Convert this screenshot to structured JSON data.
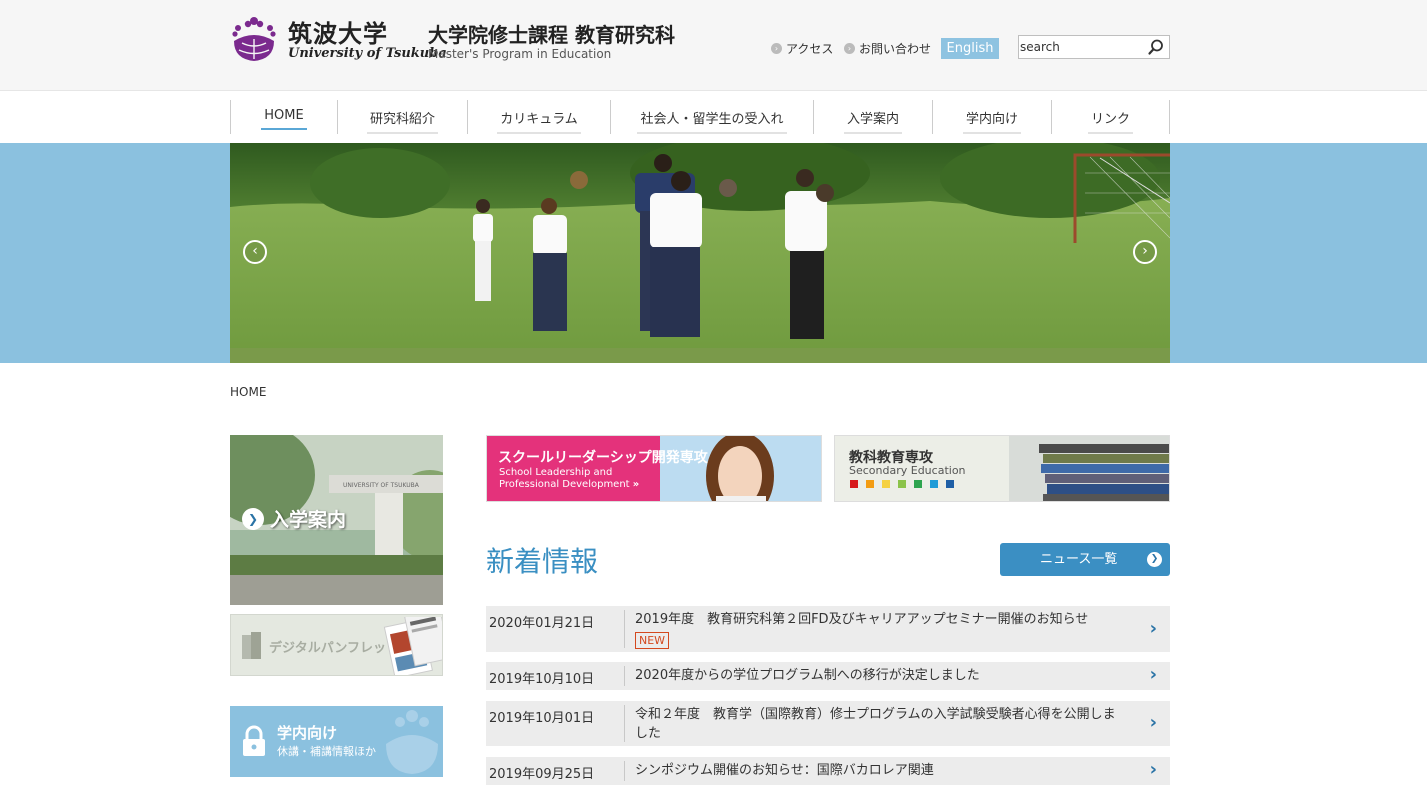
{
  "header": {
    "university_jp": "筑波大学",
    "university_en": "University of Tsukuba",
    "program_jp": "大学院修士課程 教育研究科",
    "program_en": "Master's Program in Education",
    "links": [
      {
        "label": "アクセス",
        "icon": "chevron-right-icon"
      },
      {
        "label": "お問い合わせ",
        "icon": "chevron-right-icon"
      }
    ],
    "lang_button": "English",
    "search": {
      "value": "search",
      "icon": "search-icon"
    }
  },
  "nav": {
    "items": [
      {
        "label": "HOME",
        "active": true
      },
      {
        "label": "研究科紹介",
        "active": false
      },
      {
        "label": "カリキュラム",
        "active": false
      },
      {
        "label": "社会人・留学生の受入れ",
        "active": false
      },
      {
        "label": "入学案内",
        "active": false
      },
      {
        "label": "学内向け",
        "active": false
      },
      {
        "label": "リンク",
        "active": false
      }
    ]
  },
  "hero": {
    "prev_icon": "chevron-left-icon",
    "next_icon": "chevron-right-icon"
  },
  "breadcrumb": "HOME",
  "side": {
    "admission": "入学案内",
    "pamphlet": "デジタルパンフレット",
    "internal_title": "学内向け",
    "internal_sub": "休講・補講情報ほか",
    "gate_sign": "UNIVERSITY OF TSUKUBA"
  },
  "banners": {
    "leadership": {
      "jp": "スクールリーダーシップ開発専攻",
      "en_line1": "School Leadership and",
      "en_line2": "Professional Development"
    },
    "secondary": {
      "jp": "教科教育専攻",
      "en": "Secondary Education",
      "swatches": [
        "#d7191c",
        "#f39c12",
        "#f5d142",
        "#8bc34a",
        "#2ea44f",
        "#1e9bd7",
        "#1f5fa6"
      ]
    }
  },
  "news": {
    "heading": "新着情報",
    "all_button": "ニュース一覧",
    "items": [
      {
        "date": "2020年01月21日",
        "title": "2019年度　教育研究科第２回FD及びキャリアアップセミナー開催のお知らせ",
        "badge": "NEW"
      },
      {
        "date": "2019年10月10日",
        "title": "2020年度からの学位プログラム制への移行が決定しました"
      },
      {
        "date": "2019年10月01日",
        "title": "令和２年度　教育学（国際教育）修士プログラムの入学試験受験者心得を公開しました"
      },
      {
        "date": "2019年09月25日",
        "title": "シンポジウム開催のお知らせ：国際バカロレア関連"
      }
    ]
  },
  "colors": {
    "accent": "#3b8fc3",
    "pink": "#e4327b",
    "band": "#8bc1df"
  }
}
